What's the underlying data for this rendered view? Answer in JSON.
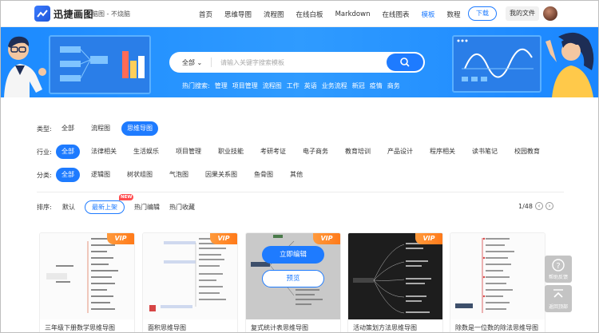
{
  "header": {
    "brand": "迅捷画图",
    "tagline": "脑图 - 不烧脑",
    "nav": [
      "首页",
      "思维导图",
      "流程图",
      "在线白板",
      "Markdown",
      "在线图表",
      "模板",
      "数程"
    ],
    "nav_active_index": 6,
    "download_label": "下载",
    "my_files_label": "我的文件"
  },
  "banner": {
    "search_select": "全部",
    "search_placeholder": "请输入关键字搜索模板",
    "hot_label": "热门搜索:",
    "hot_terms": [
      "管理",
      "项目管理",
      "流程图",
      "工作",
      "英语",
      "业务流程",
      "新冠",
      "疫情",
      "商务"
    ]
  },
  "filters": {
    "type": {
      "label": "类型:",
      "options": [
        "全部",
        "流程图",
        "思维导图"
      ],
      "active": 2
    },
    "industry": {
      "label": "行业:",
      "options": [
        "全部",
        "法律相关",
        "生活娱乐",
        "项目管理",
        "职业技能",
        "考研考证",
        "电子商务",
        "教育培训",
        "产品设计",
        "程序相关",
        "读书笔记",
        "校园教育"
      ],
      "active": 0
    },
    "category": {
      "label": "分类:",
      "options": [
        "全部",
        "逻辑图",
        "树状组图",
        "气泡图",
        "因果关系图",
        "鱼骨图",
        "其他"
      ],
      "active": 0
    }
  },
  "sort": {
    "label": "排序:",
    "options": [
      "默认",
      "最新上架",
      "热门编辑",
      "热门收藏"
    ],
    "active": 1,
    "new_badge": "NEW"
  },
  "pager": {
    "text": "1/48"
  },
  "cards": [
    {
      "title": "三年级下册数学思维导图",
      "vip": "VIP"
    },
    {
      "title": "面积思维导图",
      "vip": "VIP"
    },
    {
      "title": "复式统计表思维导图",
      "vip": "VIP",
      "edit_label": "立即编辑",
      "preview_label": "预览"
    },
    {
      "title": "活动策划方法思维导图",
      "vip": "VIP"
    },
    {
      "title": "除数是一位数的除法思维导图",
      "vip": ""
    }
  ],
  "side": {
    "help_label": "帮助反馈",
    "top_label": "返回顶部"
  },
  "colors": {
    "accent": "#1e7bff",
    "vip": "#ff8a2a",
    "banner": "#2a93ff"
  }
}
